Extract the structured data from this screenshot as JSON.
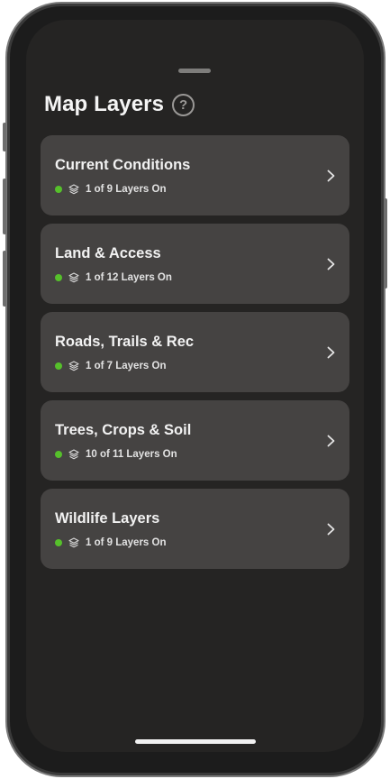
{
  "sheet": {
    "title": "Map Layers",
    "help_icon": "question-circle-icon"
  },
  "status_color": "#56c02b",
  "categories": [
    {
      "title": "Current Conditions",
      "status": "1 of 9 Layers On"
    },
    {
      "title": "Land & Access",
      "status": "1 of 12 Layers On"
    },
    {
      "title": "Roads, Trails & Rec",
      "status": "1 of 7 Layers On"
    },
    {
      "title": "Trees, Crops & Soil",
      "status": "10 of 11 Layers On"
    },
    {
      "title": "Wildlife Layers",
      "status": "1 of 9 Layers On"
    }
  ]
}
